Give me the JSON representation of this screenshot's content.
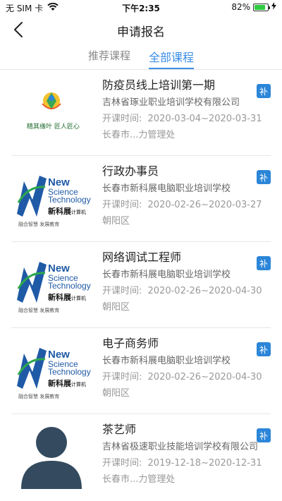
{
  "status_bar": {
    "carrier": "无 SIM 卡",
    "time": "下午2:35",
    "battery": "82%",
    "battery_level": 0.82
  },
  "nav": {
    "title": "申请报名",
    "back_icon": "chevron-left-icon"
  },
  "tabs": [
    {
      "label": "推荐课程",
      "active": false
    },
    {
      "label": "全部课程",
      "active": true
    }
  ],
  "courses": [
    {
      "name": "防疫员线上培训第一期",
      "school": "吉林省琢业职业培训学校有限公司",
      "time_label": "开课时间:",
      "time_range": "2020-03-04~2020-03-31",
      "address": "长春市...力管理处",
      "badge": "补",
      "logo_slogan": "精其缘叶 匠人匠心"
    },
    {
      "name": "行政办事员",
      "school": "长春市新科展电脑职业培训学校",
      "time_label": "开课时间:",
      "time_range": "2020-02-26~2020-03-27",
      "address": "朝阳区",
      "badge": "补",
      "logo": {
        "line1": "New",
        "line2": "Science",
        "line3": "Technology",
        "cn": "新科展",
        "cn_small": "计算机",
        "sub": "融合智慧 发展教育"
      }
    },
    {
      "name": "网络调试工程师",
      "school": "长春市新科展电脑职业培训学校",
      "time_label": "开课时间:",
      "time_range": "2020-02-26~2020-04-30",
      "address": "朝阳区",
      "badge": "补",
      "logo": {
        "line1": "New",
        "line2": "Science",
        "line3": "Technology",
        "cn": "新科展",
        "cn_small": "计算机",
        "sub": "融合智慧 发展教育"
      }
    },
    {
      "name": "电子商务师",
      "school": "长春市新科展电脑职业培训学校",
      "time_label": "开课时间:",
      "time_range": "2020-02-26~2020-04-30",
      "address": "朝阳区",
      "badge": "补",
      "logo": {
        "line1": "New",
        "line2": "Science",
        "line3": "Technology",
        "cn": "新科展",
        "cn_small": "计算机",
        "sub": "融合智慧 发展教育"
      }
    },
    {
      "name": "茶艺师",
      "school": "吉林省极速职业技能培训学校有限公司",
      "time_label": "开课时间:",
      "time_range": "2019-12-18~2020-12-31",
      "address": "长春市...力管理处",
      "badge": "补"
    }
  ],
  "colors": {
    "accent": "#3a8ee6",
    "badge": "#2b86d8"
  }
}
